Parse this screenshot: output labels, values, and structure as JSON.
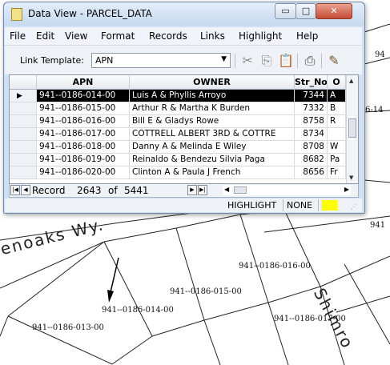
{
  "window": {
    "title": "Data View - PARCEL_DATA",
    "buttons": {
      "minimize": "▭",
      "maximize": "□",
      "close": "✕"
    }
  },
  "menubar": [
    "File",
    "Edit",
    "View",
    "Format",
    "Records",
    "Links",
    "Highlight",
    "Help"
  ],
  "toolbar": {
    "link_template_label": "Link Template:",
    "link_template_value": "APN",
    "icons": [
      "cut-icon",
      "copy-icon",
      "paste-icon",
      "print-icon",
      "edit-tool-icon"
    ]
  },
  "table": {
    "columns": [
      "APN",
      "OWNER",
      "Str_No",
      "O"
    ],
    "rows": [
      [
        "941--0186-014-00",
        "Luis A & Phyllis Arroyo",
        "7344",
        "A"
      ],
      [
        "941--0186-015-00",
        "Arthur R & Martha K Burden",
        "7332",
        "B"
      ],
      [
        "941--0186-016-00",
        "Bill E & Gladys Rowe",
        "8758",
        "R"
      ],
      [
        "941--0186-017-00",
        "COTTRELL ALBERT 3RD & COTTRE",
        "8734",
        ""
      ],
      [
        "941--0186-018-00",
        "Danny A & Melinda E Wiley",
        "8708",
        "W"
      ],
      [
        "941--0186-019-00",
        "Reinaldo & Bendezu Silvia Paga",
        "8682",
        "Pa"
      ],
      [
        "941--0186-020-00",
        "Clinton A & Paula J French",
        "8656",
        "Fr"
      ]
    ],
    "selected_row": 0
  },
  "navigation": {
    "record_label": "Record",
    "current": "2643",
    "of_label": "of",
    "total": "5441"
  },
  "statusbar": {
    "highlight_label": "HIGHLIGHT",
    "highlight_value": "NONE",
    "highlight_color": "#ffff00"
  },
  "map": {
    "street_1": "enoaks Wy.",
    "street_2": "Shimro",
    "parcel_labels": [
      "941--0186-016-00",
      "941--0186-015-00",
      "941--0186-014-00",
      "941--0186-013-00",
      "941--0186-017-00",
      "6-14",
      "94",
      "941"
    ]
  }
}
